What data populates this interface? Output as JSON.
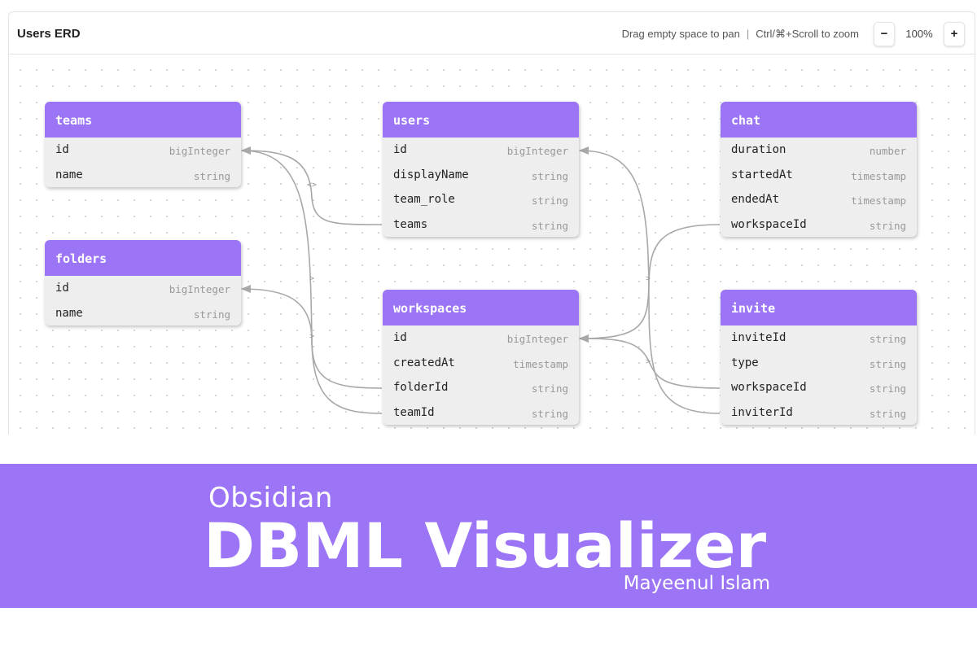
{
  "header": {
    "title": "Users ERD",
    "hint_pan": "Drag empty space to pan",
    "hint_sep": "|",
    "hint_zoom": "Ctrl/⌘+Scroll to zoom",
    "zoom_out_label": "−",
    "zoom_level": "100%",
    "zoom_in_label": "+"
  },
  "tables": {
    "teams": {
      "name": "teams",
      "columns": [
        {
          "name": "id",
          "type": "bigInteger"
        },
        {
          "name": "name",
          "type": "string"
        }
      ]
    },
    "folders": {
      "name": "folders",
      "columns": [
        {
          "name": "id",
          "type": "bigInteger"
        },
        {
          "name": "name",
          "type": "string"
        }
      ]
    },
    "users": {
      "name": "users",
      "columns": [
        {
          "name": "id",
          "type": "bigInteger"
        },
        {
          "name": "displayName",
          "type": "string"
        },
        {
          "name": "team_role",
          "type": "string"
        },
        {
          "name": "teams",
          "type": "string"
        }
      ]
    },
    "workspaces": {
      "name": "workspaces",
      "columns": [
        {
          "name": "id",
          "type": "bigInteger"
        },
        {
          "name": "createdAt",
          "type": "timestamp"
        },
        {
          "name": "folderId",
          "type": "string"
        },
        {
          "name": "teamId",
          "type": "string"
        }
      ]
    },
    "chat": {
      "name": "chat",
      "columns": [
        {
          "name": "duration",
          "type": "number"
        },
        {
          "name": "startedAt",
          "type": "timestamp"
        },
        {
          "name": "endedAt",
          "type": "timestamp"
        },
        {
          "name": "workspaceId",
          "type": "string"
        }
      ]
    },
    "invite": {
      "name": "invite",
      "columns": [
        {
          "name": "inviteId",
          "type": "string"
        },
        {
          "name": "type",
          "type": "string"
        },
        {
          "name": "workspaceId",
          "type": "string"
        },
        {
          "name": "inviterId",
          "type": "string"
        }
      ]
    }
  },
  "relations": [
    {
      "from": "users.teams",
      "to": "teams.id",
      "marker": "<>"
    },
    {
      "from": "workspaces.teamId",
      "to": "teams.id",
      "marker": ">"
    },
    {
      "from": "workspaces.folderId",
      "to": "folders.id",
      "marker": ">"
    },
    {
      "from": "chat.workspaceId",
      "to": "workspaces.id",
      "marker": ">"
    },
    {
      "from": "invite.workspaceId",
      "to": "workspaces.id",
      "marker": ">"
    },
    {
      "from": "invite.inviterId",
      "to": "users.id",
      "marker": ">"
    }
  ],
  "colors": {
    "table_header": "#9b75f5",
    "table_body": "#eeeeee",
    "link": "#a8a8a8",
    "banner": "#9b75f5"
  },
  "banner": {
    "subtitle": "Obsidian",
    "title": "DBML Visualizer",
    "author": "Mayeenul Islam"
  }
}
